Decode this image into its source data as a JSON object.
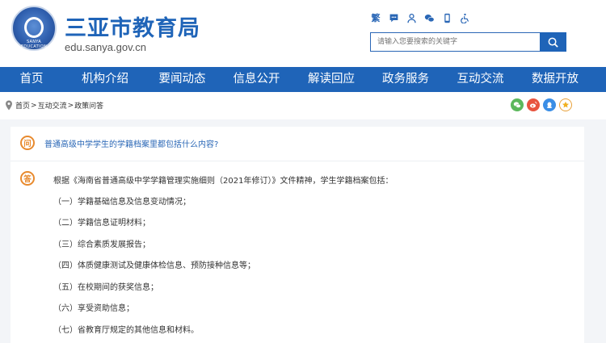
{
  "header": {
    "site_title": "三亚市教育局",
    "domain": "edu.sanya.gov.cn",
    "logo_text": "SANYA EDUCATION",
    "toolbar": {
      "traditional_label": "繁"
    },
    "search": {
      "placeholder": "请输入您要搜索的关键字"
    }
  },
  "nav": {
    "items": [
      "首页",
      "机构介绍",
      "要闻动态",
      "信息公开",
      "解读回应",
      "政务服务",
      "互动交流",
      "数据开放"
    ]
  },
  "breadcrumb": {
    "items": [
      "首页",
      "互动交流",
      "政策问答"
    ],
    "separator": ">"
  },
  "qa": {
    "question_badge": "问",
    "question": "普通高级中学学生的学籍档案里都包括什么内容?",
    "answer_badge": "答",
    "answer_intro": "根据《海南省普通高级中学学籍管理实施细则（2021年修订）》文件精神，学生学籍档案包括：",
    "answer_items": [
      "（一）学籍基础信息及信息变动情况；",
      "（二）学籍信息证明材料；",
      "（三）综合素质发展报告；",
      "（四）体质健康测试及健康体检信息、预防接种信息等；",
      "（五）在校期间的获奖信息；",
      "（六）享受资助信息；",
      "（七）省教育厅规定的其他信息和材料。"
    ]
  },
  "colors": {
    "brand_blue": "#1f64b8",
    "accent_orange": "#e88a2e",
    "panel_bg": "#f3f5f8"
  }
}
